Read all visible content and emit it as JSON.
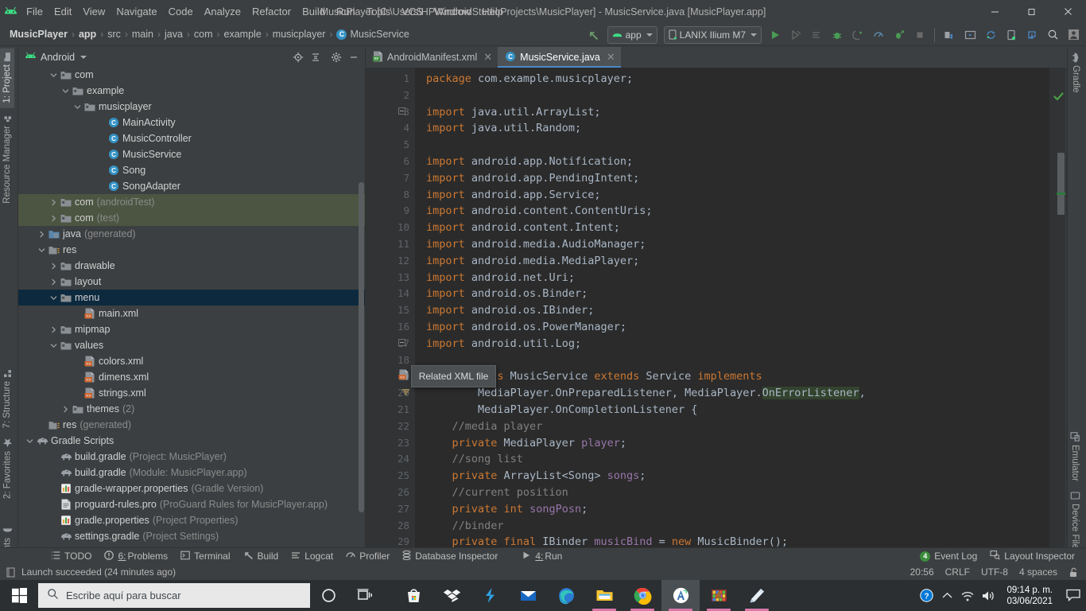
{
  "window": {
    "title": "MusicPlayer [C:\\Users\\HP\\AndroidStudioProjects\\MusicPlayer] - MusicService.java [MusicPlayer.app]",
    "minimize": "—",
    "maximize": "❐",
    "close": "✕"
  },
  "menubar": {
    "items": [
      "File",
      "Edit",
      "View",
      "Navigate",
      "Code",
      "Analyze",
      "Refactor",
      "Build",
      "Run",
      "Tools",
      "VCS",
      "Window",
      "Help"
    ]
  },
  "breadcrumb": {
    "items": [
      "MusicPlayer",
      "app",
      "src",
      "main",
      "java",
      "com",
      "example",
      "musicplayer"
    ],
    "last": "MusicService",
    "last_badge": "C",
    "separator": "›"
  },
  "toolbar": {
    "module_selector": "app",
    "device_selector": "LANIX Ilium M7",
    "icons": [
      "back-arrow-icon",
      "run-icon",
      "apply-changes-icon",
      "apply-code-changes-icon",
      "debug-icon",
      "attach-debugger-icon",
      "profiler-icon",
      "run-with-coverage-icon",
      "stop-icon",
      "sdk-manager-icon",
      "avd-manager-icon",
      "sync-gradle-icon",
      "device-manager-icon",
      "layout-inspector-icon",
      "search-everywhere-icon",
      "user-account-icon"
    ]
  },
  "left_strip": {
    "top": [
      {
        "label": "1: Project",
        "icon": "project-icon",
        "active": true
      },
      {
        "label": "Resource Manager",
        "icon": "resource-manager-icon",
        "active": false
      }
    ],
    "middle": [
      {
        "label": "7: Structure",
        "icon": "structure-icon",
        "active": false
      },
      {
        "label": "2: Favorites",
        "icon": "star-icon",
        "active": false
      }
    ],
    "bottom": [
      {
        "label": "Build Variants",
        "icon": "build-variants-icon",
        "active": false
      }
    ]
  },
  "right_strip": {
    "top": [
      {
        "label": "Gradle",
        "icon": "gradle-elephant-icon"
      }
    ],
    "bottom": [
      {
        "label": "Emulator",
        "icon": "emulator-icon"
      },
      {
        "label": "Device File Explorer",
        "icon": "device-file-explorer-icon"
      }
    ]
  },
  "project_panel": {
    "title": "Android",
    "dropdown_caret": "▾",
    "header_icons": [
      "locate-icon",
      "collapse-all-icon",
      "settings-gear-icon",
      "hide-icon"
    ],
    "tree": [
      {
        "indent": 2,
        "arrow": "down",
        "icon": "package-folder",
        "label": "com",
        "dim": ""
      },
      {
        "indent": 3,
        "arrow": "down",
        "icon": "package-folder",
        "label": "example",
        "dim": ""
      },
      {
        "indent": 4,
        "arrow": "down",
        "icon": "package-folder",
        "label": "musicplayer",
        "dim": ""
      },
      {
        "indent": 6,
        "arrow": "none",
        "icon": "java-class",
        "label": "MainActivity",
        "dim": ""
      },
      {
        "indent": 6,
        "arrow": "none",
        "icon": "java-class",
        "label": "MusicController",
        "dim": ""
      },
      {
        "indent": 6,
        "arrow": "none",
        "icon": "java-class",
        "label": "MusicService",
        "dim": ""
      },
      {
        "indent": 6,
        "arrow": "none",
        "icon": "java-class",
        "label": "Song",
        "dim": ""
      },
      {
        "indent": 6,
        "arrow": "none",
        "icon": "java-class",
        "label": "SongAdapter",
        "dim": ""
      },
      {
        "indent": 2,
        "arrow": "right",
        "icon": "package-folder",
        "label": "com",
        "dim": "(androidTest)",
        "sel": "green"
      },
      {
        "indent": 2,
        "arrow": "right",
        "icon": "package-folder",
        "label": "com",
        "dim": "(test)",
        "sel": "green"
      },
      {
        "indent": 1,
        "arrow": "right",
        "icon": "generated-folder",
        "label": "java",
        "dim": "(generated)"
      },
      {
        "indent": 1,
        "arrow": "down",
        "icon": "res-folder",
        "label": "res",
        "dim": ""
      },
      {
        "indent": 2,
        "arrow": "right",
        "icon": "package-folder",
        "label": "drawable",
        "dim": ""
      },
      {
        "indent": 2,
        "arrow": "right",
        "icon": "package-folder",
        "label": "layout",
        "dim": ""
      },
      {
        "indent": 2,
        "arrow": "down",
        "icon": "package-folder",
        "label": "menu",
        "dim": "",
        "sel": "blue"
      },
      {
        "indent": 4,
        "arrow": "none",
        "icon": "xml-file",
        "label": "main.xml",
        "dim": ""
      },
      {
        "indent": 2,
        "arrow": "right",
        "icon": "package-folder",
        "label": "mipmap",
        "dim": ""
      },
      {
        "indent": 2,
        "arrow": "down",
        "icon": "package-folder",
        "label": "values",
        "dim": ""
      },
      {
        "indent": 4,
        "arrow": "none",
        "icon": "xml-file",
        "label": "colors.xml",
        "dim": ""
      },
      {
        "indent": 4,
        "arrow": "none",
        "icon": "xml-file",
        "label": "dimens.xml",
        "dim": ""
      },
      {
        "indent": 4,
        "arrow": "none",
        "icon": "xml-file",
        "label": "strings.xml",
        "dim": ""
      },
      {
        "indent": 3,
        "arrow": "right",
        "icon": "package-folder",
        "label": "themes",
        "dim": "(2)"
      },
      {
        "indent": 1,
        "arrow": "none",
        "icon": "res-folder",
        "label": "res",
        "dim": "(generated)"
      },
      {
        "indent": 0,
        "arrow": "down",
        "icon": "gradle-elephant",
        "label": "Gradle Scripts",
        "dim": ""
      },
      {
        "indent": 2,
        "arrow": "none",
        "icon": "gradle-elephant",
        "label": "build.gradle",
        "dim": "(Project: MusicPlayer)"
      },
      {
        "indent": 2,
        "arrow": "none",
        "icon": "gradle-elephant",
        "label": "build.gradle",
        "dim": "(Module: MusicPlayer.app)"
      },
      {
        "indent": 2,
        "arrow": "none",
        "icon": "properties-file",
        "label": "gradle-wrapper.properties",
        "dim": "(Gradle Version)"
      },
      {
        "indent": 2,
        "arrow": "none",
        "icon": "text-file",
        "label": "proguard-rules.pro",
        "dim": "(ProGuard Rules for MusicPlayer.app)"
      },
      {
        "indent": 2,
        "arrow": "none",
        "icon": "properties-file",
        "label": "gradle.properties",
        "dim": "(Project Properties)"
      },
      {
        "indent": 2,
        "arrow": "none",
        "icon": "gradle-elephant",
        "label": "settings.gradle",
        "dim": "(Project Settings)"
      }
    ]
  },
  "editor": {
    "tabs": [
      {
        "label": "AndroidManifest.xml",
        "icon": "manifest-file-icon",
        "active": false,
        "close": "✕"
      },
      {
        "label": "MusicService.java",
        "icon": "java-class-icon",
        "active": true,
        "close": "✕"
      }
    ],
    "tooltip": "Related XML file",
    "first_line": 1,
    "lines": [
      {
        "n": 1,
        "segs": [
          {
            "t": "package ",
            "c": "kw"
          },
          {
            "t": "com.example.musicplayer;",
            "c": "txt"
          }
        ]
      },
      {
        "n": 2,
        "segs": []
      },
      {
        "n": 3,
        "segs": [
          {
            "t": "import ",
            "c": "kw"
          },
          {
            "t": "java.util.ArrayList;",
            "c": "txt"
          }
        ]
      },
      {
        "n": 4,
        "segs": [
          {
            "t": "import ",
            "c": "kw"
          },
          {
            "t": "java.util.Random;",
            "c": "txt"
          }
        ]
      },
      {
        "n": 5,
        "segs": []
      },
      {
        "n": 6,
        "segs": [
          {
            "t": "import ",
            "c": "kw"
          },
          {
            "t": "android.app.Notification;",
            "c": "txt"
          }
        ]
      },
      {
        "n": 7,
        "segs": [
          {
            "t": "import ",
            "c": "kw"
          },
          {
            "t": "android.app.PendingIntent;",
            "c": "txt"
          }
        ]
      },
      {
        "n": 8,
        "segs": [
          {
            "t": "import ",
            "c": "kw"
          },
          {
            "t": "android.app.Service;",
            "c": "txt"
          }
        ]
      },
      {
        "n": 9,
        "segs": [
          {
            "t": "import ",
            "c": "kw"
          },
          {
            "t": "android.content.ContentUris;",
            "c": "txt"
          }
        ]
      },
      {
        "n": 10,
        "segs": [
          {
            "t": "import ",
            "c": "kw"
          },
          {
            "t": "android.content.Intent;",
            "c": "txt"
          }
        ]
      },
      {
        "n": 11,
        "segs": [
          {
            "t": "import ",
            "c": "kw"
          },
          {
            "t": "android.media.AudioManager;",
            "c": "txt"
          }
        ]
      },
      {
        "n": 12,
        "segs": [
          {
            "t": "import ",
            "c": "kw"
          },
          {
            "t": "android.media.MediaPlayer;",
            "c": "txt"
          }
        ]
      },
      {
        "n": 13,
        "segs": [
          {
            "t": "import ",
            "c": "kw"
          },
          {
            "t": "android.net.Uri;",
            "c": "txt"
          }
        ]
      },
      {
        "n": 14,
        "segs": [
          {
            "t": "import ",
            "c": "kw"
          },
          {
            "t": "android.os.Binder;",
            "c": "txt"
          }
        ]
      },
      {
        "n": 15,
        "segs": [
          {
            "t": "import ",
            "c": "kw"
          },
          {
            "t": "android.os.IBinder;",
            "c": "txt"
          }
        ]
      },
      {
        "n": 16,
        "segs": [
          {
            "t": "import ",
            "c": "kw"
          },
          {
            "t": "android.os.PowerManager;",
            "c": "txt"
          }
        ]
      },
      {
        "n": 17,
        "segs": [
          {
            "t": "import ",
            "c": "kw"
          },
          {
            "t": "android.util.Log;",
            "c": "txt"
          }
        ]
      },
      {
        "n": 18,
        "segs": []
      },
      {
        "n": 19,
        "segs": [
          {
            "t": "public class",
            "c": "kw"
          },
          {
            "t": " MusicService ",
            "c": "txt"
          },
          {
            "t": "extends",
            "c": "kw"
          },
          {
            "t": " Service ",
            "c": "txt"
          },
          {
            "t": "implements",
            "c": "kw"
          }
        ]
      },
      {
        "n": 20,
        "segs": [
          {
            "t": "        MediaPlayer.OnPreparedListener, MediaPlayer.",
            "c": "txt"
          },
          {
            "t": "OnErrorListener",
            "c": "hl"
          },
          {
            "t": ",",
            "c": "txt"
          }
        ]
      },
      {
        "n": 21,
        "segs": [
          {
            "t": "        MediaPlayer.OnCompletionListener {",
            "c": "txt"
          }
        ]
      },
      {
        "n": 22,
        "segs": [
          {
            "t": "    //media player",
            "c": "cm"
          }
        ]
      },
      {
        "n": 23,
        "segs": [
          {
            "t": "    private",
            "c": "kw"
          },
          {
            "t": " MediaPlayer ",
            "c": "txt"
          },
          {
            "t": "player",
            "c": "fld"
          },
          {
            "t": ";",
            "c": "txt"
          }
        ]
      },
      {
        "n": 24,
        "segs": [
          {
            "t": "    //song list",
            "c": "cm"
          }
        ]
      },
      {
        "n": 25,
        "segs": [
          {
            "t": "    private",
            "c": "kw"
          },
          {
            "t": " ArrayList<Song> ",
            "c": "txt"
          },
          {
            "t": "songs",
            "c": "fld"
          },
          {
            "t": ";",
            "c": "txt"
          }
        ]
      },
      {
        "n": 26,
        "segs": [
          {
            "t": "    //current position",
            "c": "cm"
          }
        ]
      },
      {
        "n": 27,
        "segs": [
          {
            "t": "    private int",
            "c": "kw"
          },
          {
            "t": " ",
            "c": "txt"
          },
          {
            "t": "songPosn",
            "c": "fld"
          },
          {
            "t": ";",
            "c": "txt"
          }
        ]
      },
      {
        "n": 28,
        "segs": [
          {
            "t": "    //binder",
            "c": "cm"
          }
        ]
      },
      {
        "n": 29,
        "segs": [
          {
            "t": "    private final",
            "c": "kw"
          },
          {
            "t": " IBinder ",
            "c": "txt"
          },
          {
            "t": "musicBind",
            "c": "fld"
          },
          {
            "t": " = ",
            "c": "txt"
          },
          {
            "t": "new",
            "c": "kw"
          },
          {
            "t": " MusicBinder();",
            "c": "txt"
          }
        ]
      }
    ],
    "inspection_status": "ok-check-icon"
  },
  "bottom_tools": {
    "left": [
      {
        "label": "TODO",
        "icon": "todo-icon",
        "mnemonic": ""
      },
      {
        "label": "Problems",
        "icon": "problems-icon",
        "mnemonic": "6:"
      },
      {
        "label": "Terminal",
        "icon": "terminal-icon",
        "mnemonic": ""
      },
      {
        "label": "Build",
        "icon": "build-hammer-icon",
        "mnemonic": ""
      },
      {
        "label": "Logcat",
        "icon": "logcat-icon",
        "mnemonic": ""
      },
      {
        "label": "Profiler",
        "icon": "profiler-icon",
        "mnemonic": ""
      },
      {
        "label": "Database Inspector",
        "icon": "database-icon",
        "mnemonic": ""
      },
      {
        "label": "Run",
        "icon": "run-play-icon",
        "mnemonic": "4:"
      }
    ],
    "right": [
      {
        "label": "Event Log",
        "icon": "event-log-icon",
        "badge": "4"
      },
      {
        "label": "Layout Inspector",
        "icon": "layout-inspector-icon",
        "badge": ""
      }
    ]
  },
  "statusbar": {
    "message": "Launch succeeded (24 minutes ago)",
    "caret_position": "20:56",
    "line_separator": "CRLF",
    "encoding": "UTF-8",
    "indent": "4 spaces",
    "lock_icon": "unlocked-icon"
  },
  "taskbar": {
    "start_icon": "windows-start-icon",
    "search_placeholder": "Escribe aquí para buscar",
    "search_icon": "search-icon",
    "cortana_icon": "cortana-circle-icon",
    "taskview_icon": "task-view-icon",
    "apps": [
      {
        "name": "microsoft-store-icon",
        "running": false,
        "active": false
      },
      {
        "name": "dropbox-icon",
        "running": false,
        "active": false
      },
      {
        "name": "lightning-app-icon",
        "running": false,
        "active": false
      },
      {
        "name": "mail-icon",
        "running": false,
        "active": false
      },
      {
        "name": "microsoft-edge-icon",
        "running": false,
        "active": false
      },
      {
        "name": "file-explorer-icon",
        "running": true,
        "active": false
      },
      {
        "name": "google-chrome-icon",
        "running": true,
        "active": false
      },
      {
        "name": "android-studio-icon",
        "running": true,
        "active": true
      },
      {
        "name": "winrar-icon",
        "running": true,
        "active": false
      },
      {
        "name": "sticky-notes-icon",
        "running": true,
        "active": false
      }
    ],
    "tray": [
      {
        "name": "help-question-icon"
      },
      {
        "name": "show-hidden-icons-chevron"
      },
      {
        "name": "wifi-icon"
      },
      {
        "name": "volume-icon"
      }
    ],
    "clock_time": "09:14 p. m.",
    "clock_date": "03/06/2021",
    "action_center_icon": "notification-icon"
  },
  "colors": {
    "chrome": "#3c3f41",
    "editor_bg": "#2b2b2b",
    "gutter_bg": "#313335",
    "accent_blue": "#4a88c7",
    "keyword_orange": "#cc7832",
    "text_gray": "#a9b7c6",
    "comment_gray": "#808080",
    "field_purple": "#9876aa",
    "selection_blue": "#0d293e",
    "selection_green": "#4c5542",
    "taskbar_bg": "#2b2f32"
  }
}
